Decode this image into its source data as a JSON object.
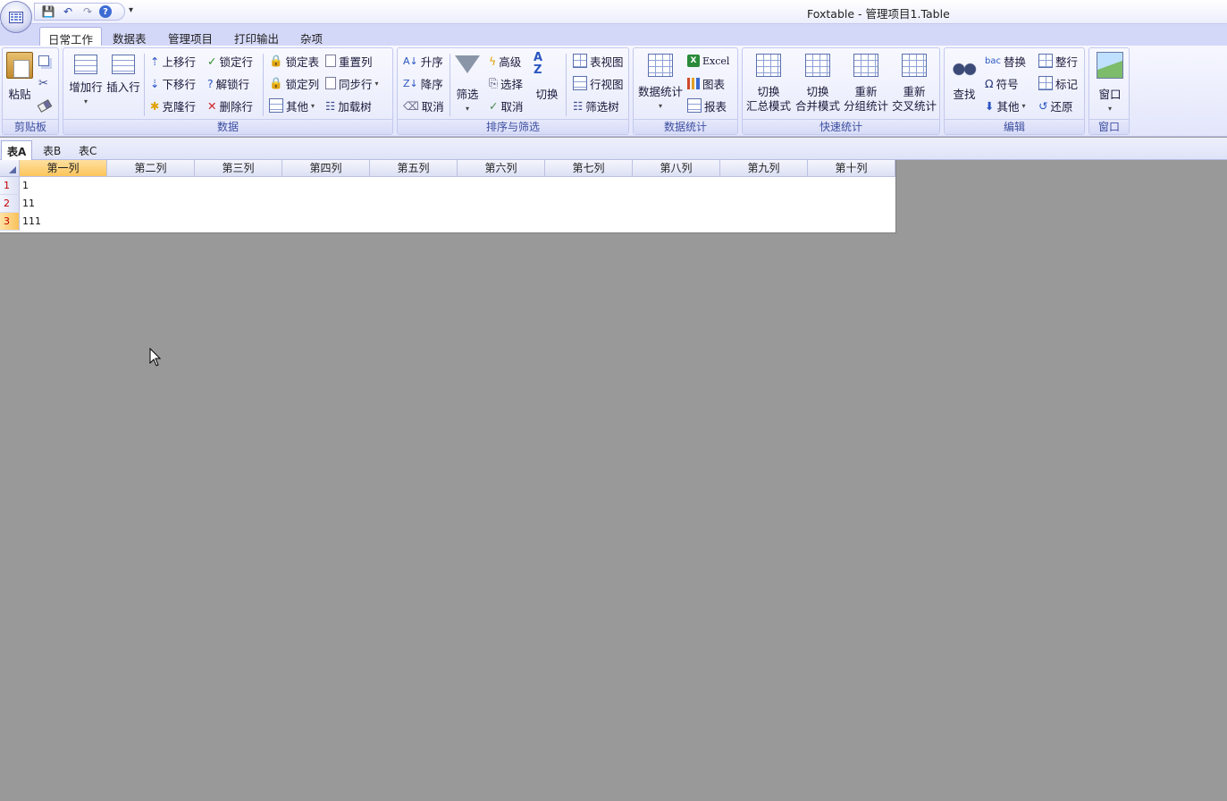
{
  "window": {
    "title": "Foxtable - 管理项目1.Table"
  },
  "quick_access": {
    "more": "▾"
  },
  "menu_tabs": [
    "日常工作",
    "数据表",
    "管理项目",
    "打印输出",
    "杂项"
  ],
  "groups": {
    "clipboard": {
      "label": "剪贴板",
      "paste": "粘贴"
    },
    "data": {
      "label": "数据",
      "add_row": "增加行",
      "insert_row": "插入行",
      "move_up": "上移行",
      "move_down": "下移行",
      "clone_row": "克隆行",
      "lock_row": "锁定行",
      "unlock_row": "解锁行",
      "delete_row": "删除行",
      "lock_table": "锁定表",
      "lock_col": "锁定列",
      "other": "其他",
      "reset_col": "重置列",
      "sync_row": "同步行",
      "load_tree": "加载树"
    },
    "sort_filter": {
      "label": "排序与筛选",
      "asc": "升序",
      "desc": "降序",
      "cancel_sort": "取消",
      "filter": "筛选",
      "advanced": "高级",
      "select": "选择",
      "cancel_filter": "取消",
      "toggle": "切换",
      "table_view": "表视图",
      "row_view": "行视图",
      "filter_tree": "筛选树"
    },
    "statistics": {
      "label": "数据统计",
      "data_stats": "数据统计",
      "excel": "Excel",
      "chart": "图表",
      "report": "报表"
    },
    "quick_stats": {
      "label": "快速统计",
      "summary_mode_1": "切换",
      "summary_mode_2": "汇总模式",
      "merge_mode_1": "切换",
      "merge_mode_2": "合并模式",
      "group_stats_1": "重新",
      "group_stats_2": "分组统计",
      "cross_stats_1": "重新",
      "cross_stats_2": "交叉统计"
    },
    "edit": {
      "label": "编辑",
      "find": "查找",
      "replace": "替换",
      "symbol": "符号",
      "other": "其他",
      "whole_row": "整行",
      "mark": "标记",
      "restore": "还原"
    },
    "window": {
      "label": "窗口",
      "window": "窗口"
    }
  },
  "sheet_tabs": [
    "表A",
    "表B",
    "表C"
  ],
  "table": {
    "columns": [
      "第一列",
      "第二列",
      "第三列",
      "第四列",
      "第五列",
      "第六列",
      "第七列",
      "第八列",
      "第九列",
      "第十列"
    ],
    "rows": [
      {
        "num": "1",
        "values": [
          "1"
        ]
      },
      {
        "num": "2",
        "values": [
          "11"
        ]
      },
      {
        "num": "3",
        "values": [
          "111"
        ]
      }
    ]
  },
  "colors": {
    "ribbon_bg": "#e3e6fb",
    "group_label": "#3d4ea0",
    "selected_header": "#fbc55a",
    "workspace": "#999999"
  }
}
